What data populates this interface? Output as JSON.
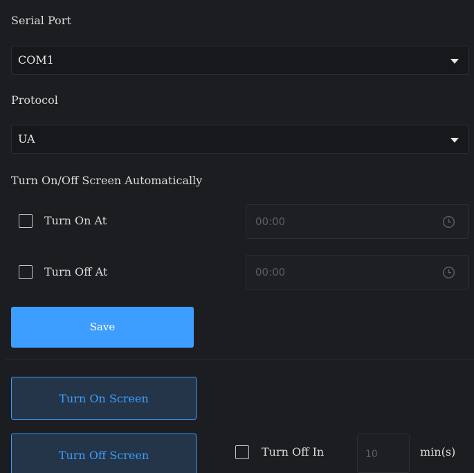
{
  "serial_port": {
    "label": "Serial Port",
    "selected": "COM1"
  },
  "protocol": {
    "label": "Protocol",
    "selected": "UA"
  },
  "auto_screen": {
    "heading": "Turn On/Off Screen Automatically",
    "turn_on": {
      "label": "Turn On At",
      "checked": false,
      "time": "00:00"
    },
    "turn_off": {
      "label": "Turn Off At",
      "checked": false,
      "time": "00:00"
    }
  },
  "actions": {
    "save_label": "Save",
    "turn_on_screen_label": "Turn On Screen",
    "turn_off_screen_label": "Turn Off Screen"
  },
  "turn_off_in": {
    "label": "Turn Off In",
    "checked": false,
    "value": "10",
    "unit": "min(s)"
  },
  "colors": {
    "background": "#1c1d21",
    "accent": "#3d9eff",
    "secondary_button_bg": "#243549",
    "muted_text": "#5b5e66"
  },
  "icons": {
    "dropdown": "caret-down-icon",
    "time": "clock-icon",
    "checkbox": "checkbox-unchecked-icon"
  }
}
